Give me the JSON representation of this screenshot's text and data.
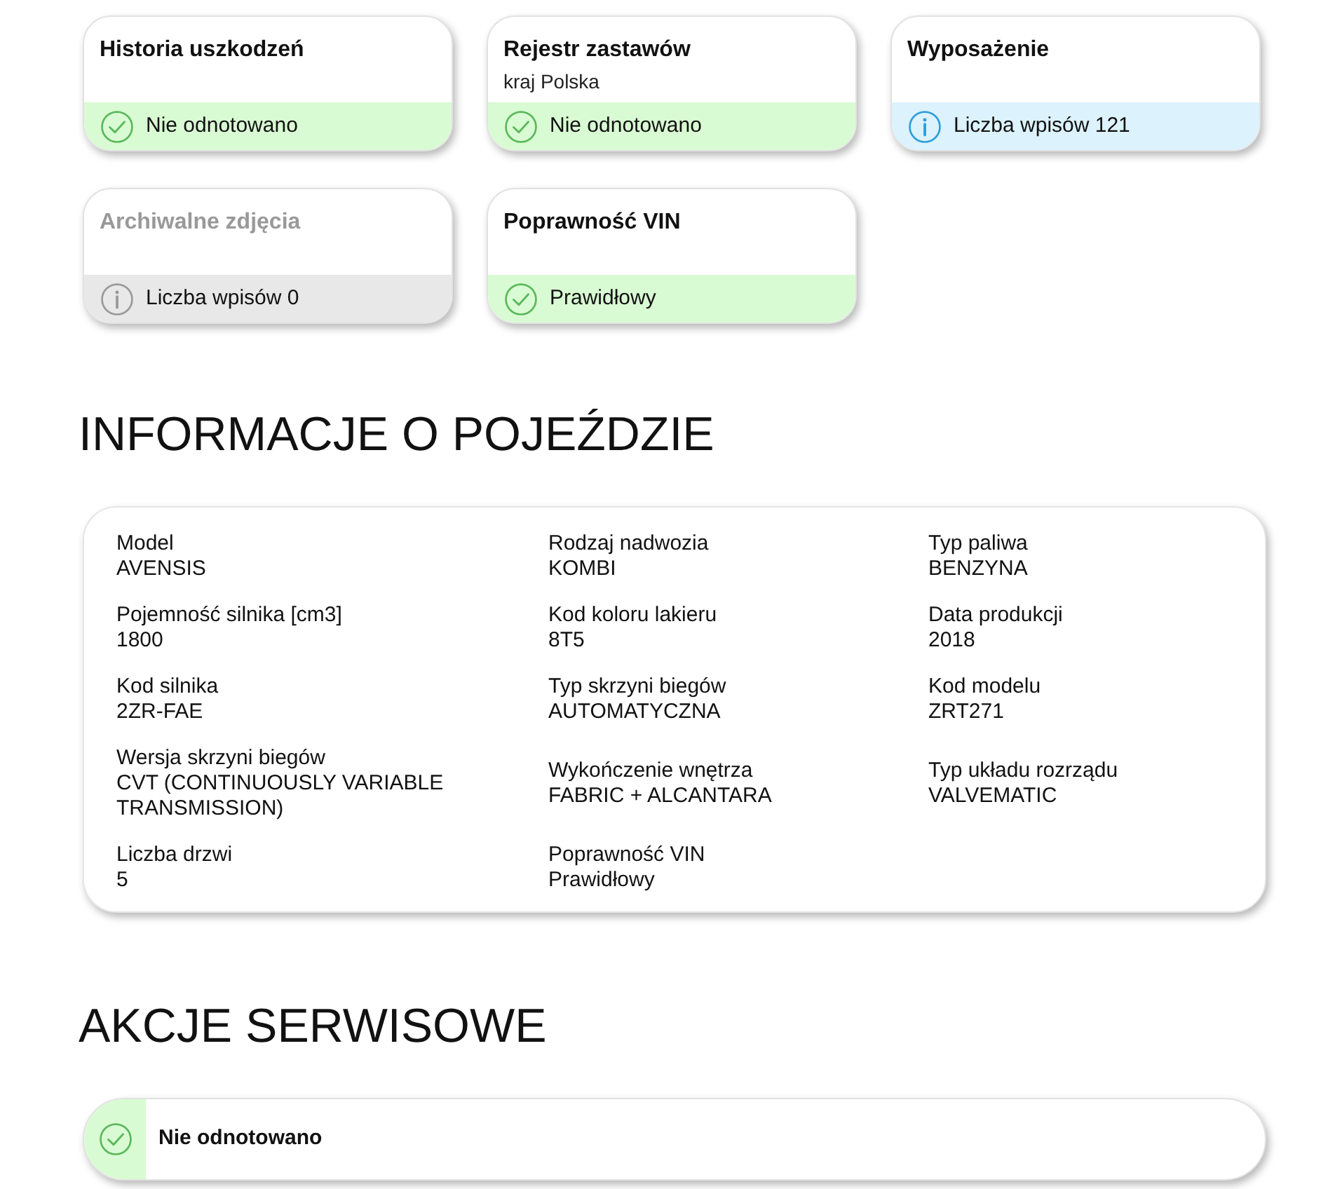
{
  "status_cards": [
    {
      "title": "Historia uszkodzeń",
      "disabled": false,
      "status": {
        "kind": "ok",
        "text": "Nie odnotowano"
      }
    },
    {
      "title": "Rejestr zastawów",
      "subtitle": "kraj Polska",
      "disabled": false,
      "status": {
        "kind": "ok",
        "text": "Nie odnotowano"
      }
    },
    {
      "title": "Wyposażenie",
      "disabled": false,
      "status": {
        "kind": "info",
        "text": "Liczba wpisów 121"
      }
    },
    {
      "title": "Archiwalne zdjęcia",
      "disabled": true,
      "status": {
        "kind": "empty",
        "text": "Liczba wpisów 0"
      }
    },
    {
      "title": "Poprawność VIN",
      "disabled": false,
      "status": {
        "kind": "ok",
        "text": "Prawidłowy"
      }
    }
  ],
  "vehicle_info": {
    "heading": "INFORMACJE O POJEŹDZIE",
    "rows": [
      [
        {
          "label": "Model",
          "value": "AVENSIS"
        },
        {
          "label": "Rodzaj nadwozia",
          "value": "KOMBI"
        },
        {
          "label": "Typ paliwa",
          "value": "BENZYNA"
        }
      ],
      [
        {
          "label": "Pojemność silnika [cm3]",
          "value": "1800"
        },
        {
          "label": "Kod koloru lakieru",
          "value": "8T5"
        },
        {
          "label": "Data produkcji",
          "value": "2018"
        }
      ],
      [
        {
          "label": "Kod silnika",
          "value": "2ZR-FAE"
        },
        {
          "label": "Typ skrzyni biegów",
          "value": "AUTOMATYCZNA"
        },
        {
          "label": "Kod modelu",
          "value": "ZRT271"
        }
      ],
      [
        {
          "label": "Wersja skrzyni biegów",
          "value": "CVT (CONTINUOUSLY VARIABLE TRANSMISSION)"
        },
        {
          "label": "Wykończenie wnętrza",
          "value": "FABRIC + ALCANTARA"
        },
        {
          "label": "Typ układu rozrządu",
          "value": "VALVEMATIC"
        }
      ],
      [
        {
          "label": "Liczba drzwi",
          "value": "5"
        },
        {
          "label": "Poprawność VIN",
          "value": "Prawidłowy"
        }
      ]
    ]
  },
  "service_actions": {
    "heading": "AKCJE SERWISOWE",
    "items": [
      {
        "kind": "ok",
        "text": "Nie odnotowano"
      }
    ]
  }
}
